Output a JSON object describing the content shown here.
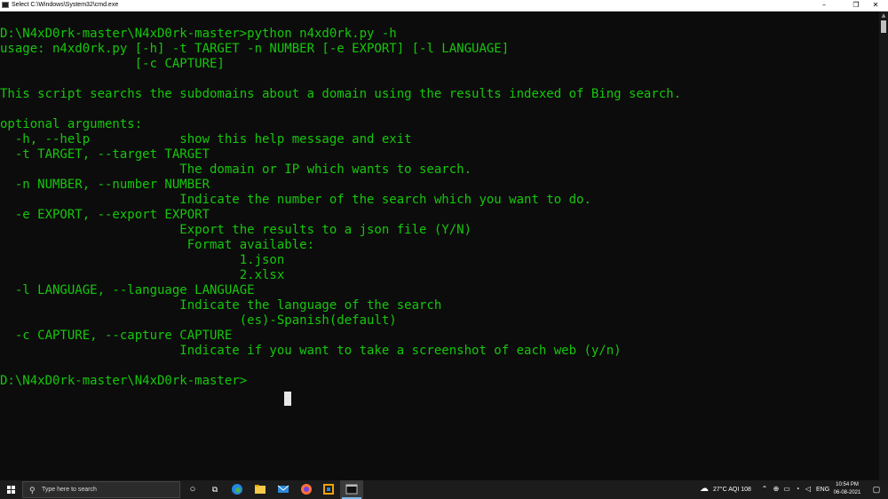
{
  "window": {
    "title": "Select C:\\Windows\\System32\\cmd.exe",
    "controls": [
      "–",
      "❐",
      "✕"
    ]
  },
  "terminal": {
    "lines": [
      "D:\\N4xD0rk-master\\N4xD0rk-master>python n4xd0rk.py -h",
      "usage: n4xd0rk.py [-h] -t TARGET -n NUMBER [-e EXPORT] [-l LANGUAGE]",
      "                  [-c CAPTURE]",
      "",
      "This script searchs the subdomains about a domain using the results indexed of Bing search.",
      "",
      "optional arguments:",
      "  -h, --help            show this help message and exit",
      "  -t TARGET, --target TARGET",
      "                        The domain or IP which wants to search.",
      "  -n NUMBER, --number NUMBER",
      "                        Indicate the number of the search which you want to do.",
      "  -e EXPORT, --export EXPORT",
      "                        Export the results to a json file (Y/N)",
      "                         Format available:",
      "                                1.json",
      "                                2.xlsx",
      "  -l LANGUAGE, --language LANGUAGE",
      "                        Indicate the language of the search",
      "                                (es)-Spanish(default)",
      "  -c CAPTURE, --capture CAPTURE",
      "                        Indicate if you want to take a screenshot of each web (y/n)",
      "",
      "D:\\N4xD0rk-master\\N4xD0rk-master>"
    ]
  },
  "colors": {
    "terminal_text": "#16c60c",
    "terminal_bg": "#0c0c0c",
    "taskbar_bg": "#1c1c1c"
  },
  "taskbar": {
    "search_placeholder": "Type here to search",
    "pinned_icons": [
      "task-view-icon",
      "timeline-icon",
      "edge-icon",
      "file-explorer-icon",
      "mail-icon",
      "firefox-icon",
      "virtual-machine-icon",
      "cmd-icon"
    ],
    "weather": "27°C  AQI 108",
    "language": "ENG",
    "time": "10:54 PM",
    "date": "06-08-2021"
  }
}
